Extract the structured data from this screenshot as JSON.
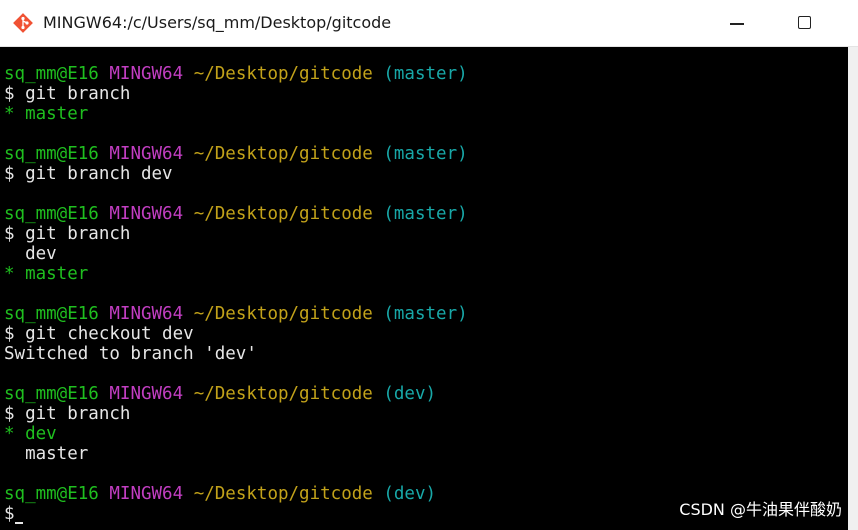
{
  "window": {
    "title": "MINGW64:/c/Users/sq_mm/Desktop/gitcode",
    "app_icon": "git-diamond-icon",
    "controls": {
      "minimize_icon": "minimize-icon",
      "maximize_icon": "maximize-icon"
    }
  },
  "theme": {
    "background": "#000000",
    "user_color": "#1fbf1f",
    "host_color": "#c23ec2",
    "path_color": "#c2a21a",
    "branch_color": "#18a8a8",
    "text_color": "#e6e6e6"
  },
  "terminal": {
    "lines": [
      {
        "kind": "prompt",
        "user": "sq_mm@E16",
        "host": "MINGW64",
        "path": "~/Desktop/gitcode",
        "branch": "(master)"
      },
      {
        "kind": "command",
        "text": "$ git branch"
      },
      {
        "kind": "active",
        "text": "* master"
      },
      {
        "kind": "blank"
      },
      {
        "kind": "prompt",
        "user": "sq_mm@E16",
        "host": "MINGW64",
        "path": "~/Desktop/gitcode",
        "branch": "(master)"
      },
      {
        "kind": "command",
        "text": "$ git branch dev"
      },
      {
        "kind": "blank"
      },
      {
        "kind": "prompt",
        "user": "sq_mm@E16",
        "host": "MINGW64",
        "path": "~/Desktop/gitcode",
        "branch": "(master)"
      },
      {
        "kind": "command",
        "text": "$ git branch"
      },
      {
        "kind": "output",
        "text": "  dev"
      },
      {
        "kind": "active",
        "text": "* master"
      },
      {
        "kind": "blank"
      },
      {
        "kind": "prompt",
        "user": "sq_mm@E16",
        "host": "MINGW64",
        "path": "~/Desktop/gitcode",
        "branch": "(master)"
      },
      {
        "kind": "command",
        "text": "$ git checkout dev"
      },
      {
        "kind": "output",
        "text": "Switched to branch 'dev'"
      },
      {
        "kind": "blank"
      },
      {
        "kind": "prompt",
        "user": "sq_mm@E16",
        "host": "MINGW64",
        "path": "~/Desktop/gitcode",
        "branch": "(dev)"
      },
      {
        "kind": "command",
        "text": "$ git branch"
      },
      {
        "kind": "active",
        "text": "* dev"
      },
      {
        "kind": "output",
        "text": "  master"
      },
      {
        "kind": "blank"
      },
      {
        "kind": "prompt",
        "user": "sq_mm@E16",
        "host": "MINGW64",
        "path": "~/Desktop/gitcode",
        "branch": "(dev)"
      },
      {
        "kind": "input",
        "text": "$"
      }
    ]
  },
  "watermark": "CSDN @牛油果伴酸奶"
}
